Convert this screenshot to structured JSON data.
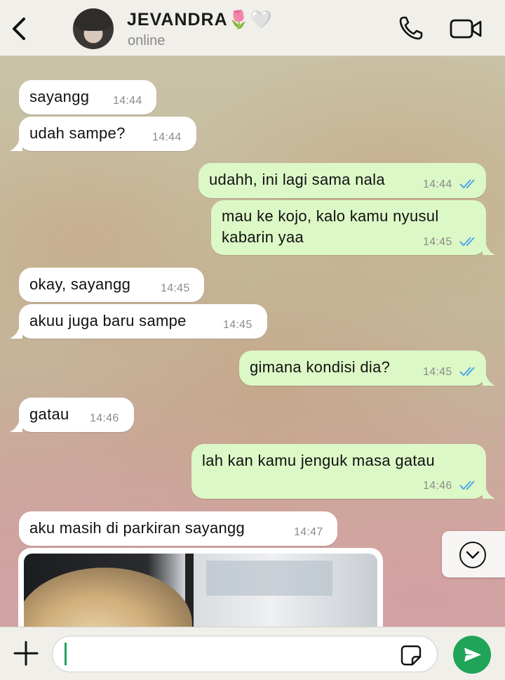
{
  "header": {
    "contact_name": "JEVANDRA🌷🤍",
    "status": "online"
  },
  "messages": [
    {
      "direction": "in",
      "text": "sayangg",
      "time": "14:44"
    },
    {
      "direction": "in",
      "text": "udah sampe?",
      "time": "14:44"
    },
    {
      "direction": "out",
      "text": "udahh, ini lagi sama nala",
      "time": "14:44",
      "read": true
    },
    {
      "direction": "out",
      "text_line1": "mau ke kojo, kalo kamu nyusul",
      "text_line2": "kabarin yaa",
      "time": "14:45",
      "read": true
    },
    {
      "direction": "in",
      "text": "okay, sayangg",
      "time": "14:45"
    },
    {
      "direction": "in",
      "text": "akuu juga baru sampe",
      "time": "14:45"
    },
    {
      "direction": "out",
      "text": "gimana kondisi dia?",
      "time": "14:45",
      "read": true
    },
    {
      "direction": "in",
      "text": "gatau",
      "time": "14:46"
    },
    {
      "direction": "out",
      "text": "lah kan kamu jenguk masa gatau",
      "time": "14:46",
      "read": true
    },
    {
      "direction": "in",
      "text": "aku masih di parkiran sayangg",
      "time": "14:47"
    }
  ],
  "composer": {
    "input_value": "",
    "input_placeholder": ""
  },
  "colors": {
    "outgoing_bubble": "#dcf8c6",
    "incoming_bubble": "#ffffff",
    "read_tick": "#4fa6e8",
    "send_button": "#1fa45a"
  },
  "icons": [
    "back-icon",
    "call-icon",
    "video-icon",
    "chevron-down-icon",
    "plus-icon",
    "sticker-icon",
    "send-icon",
    "double-check-icon"
  ]
}
